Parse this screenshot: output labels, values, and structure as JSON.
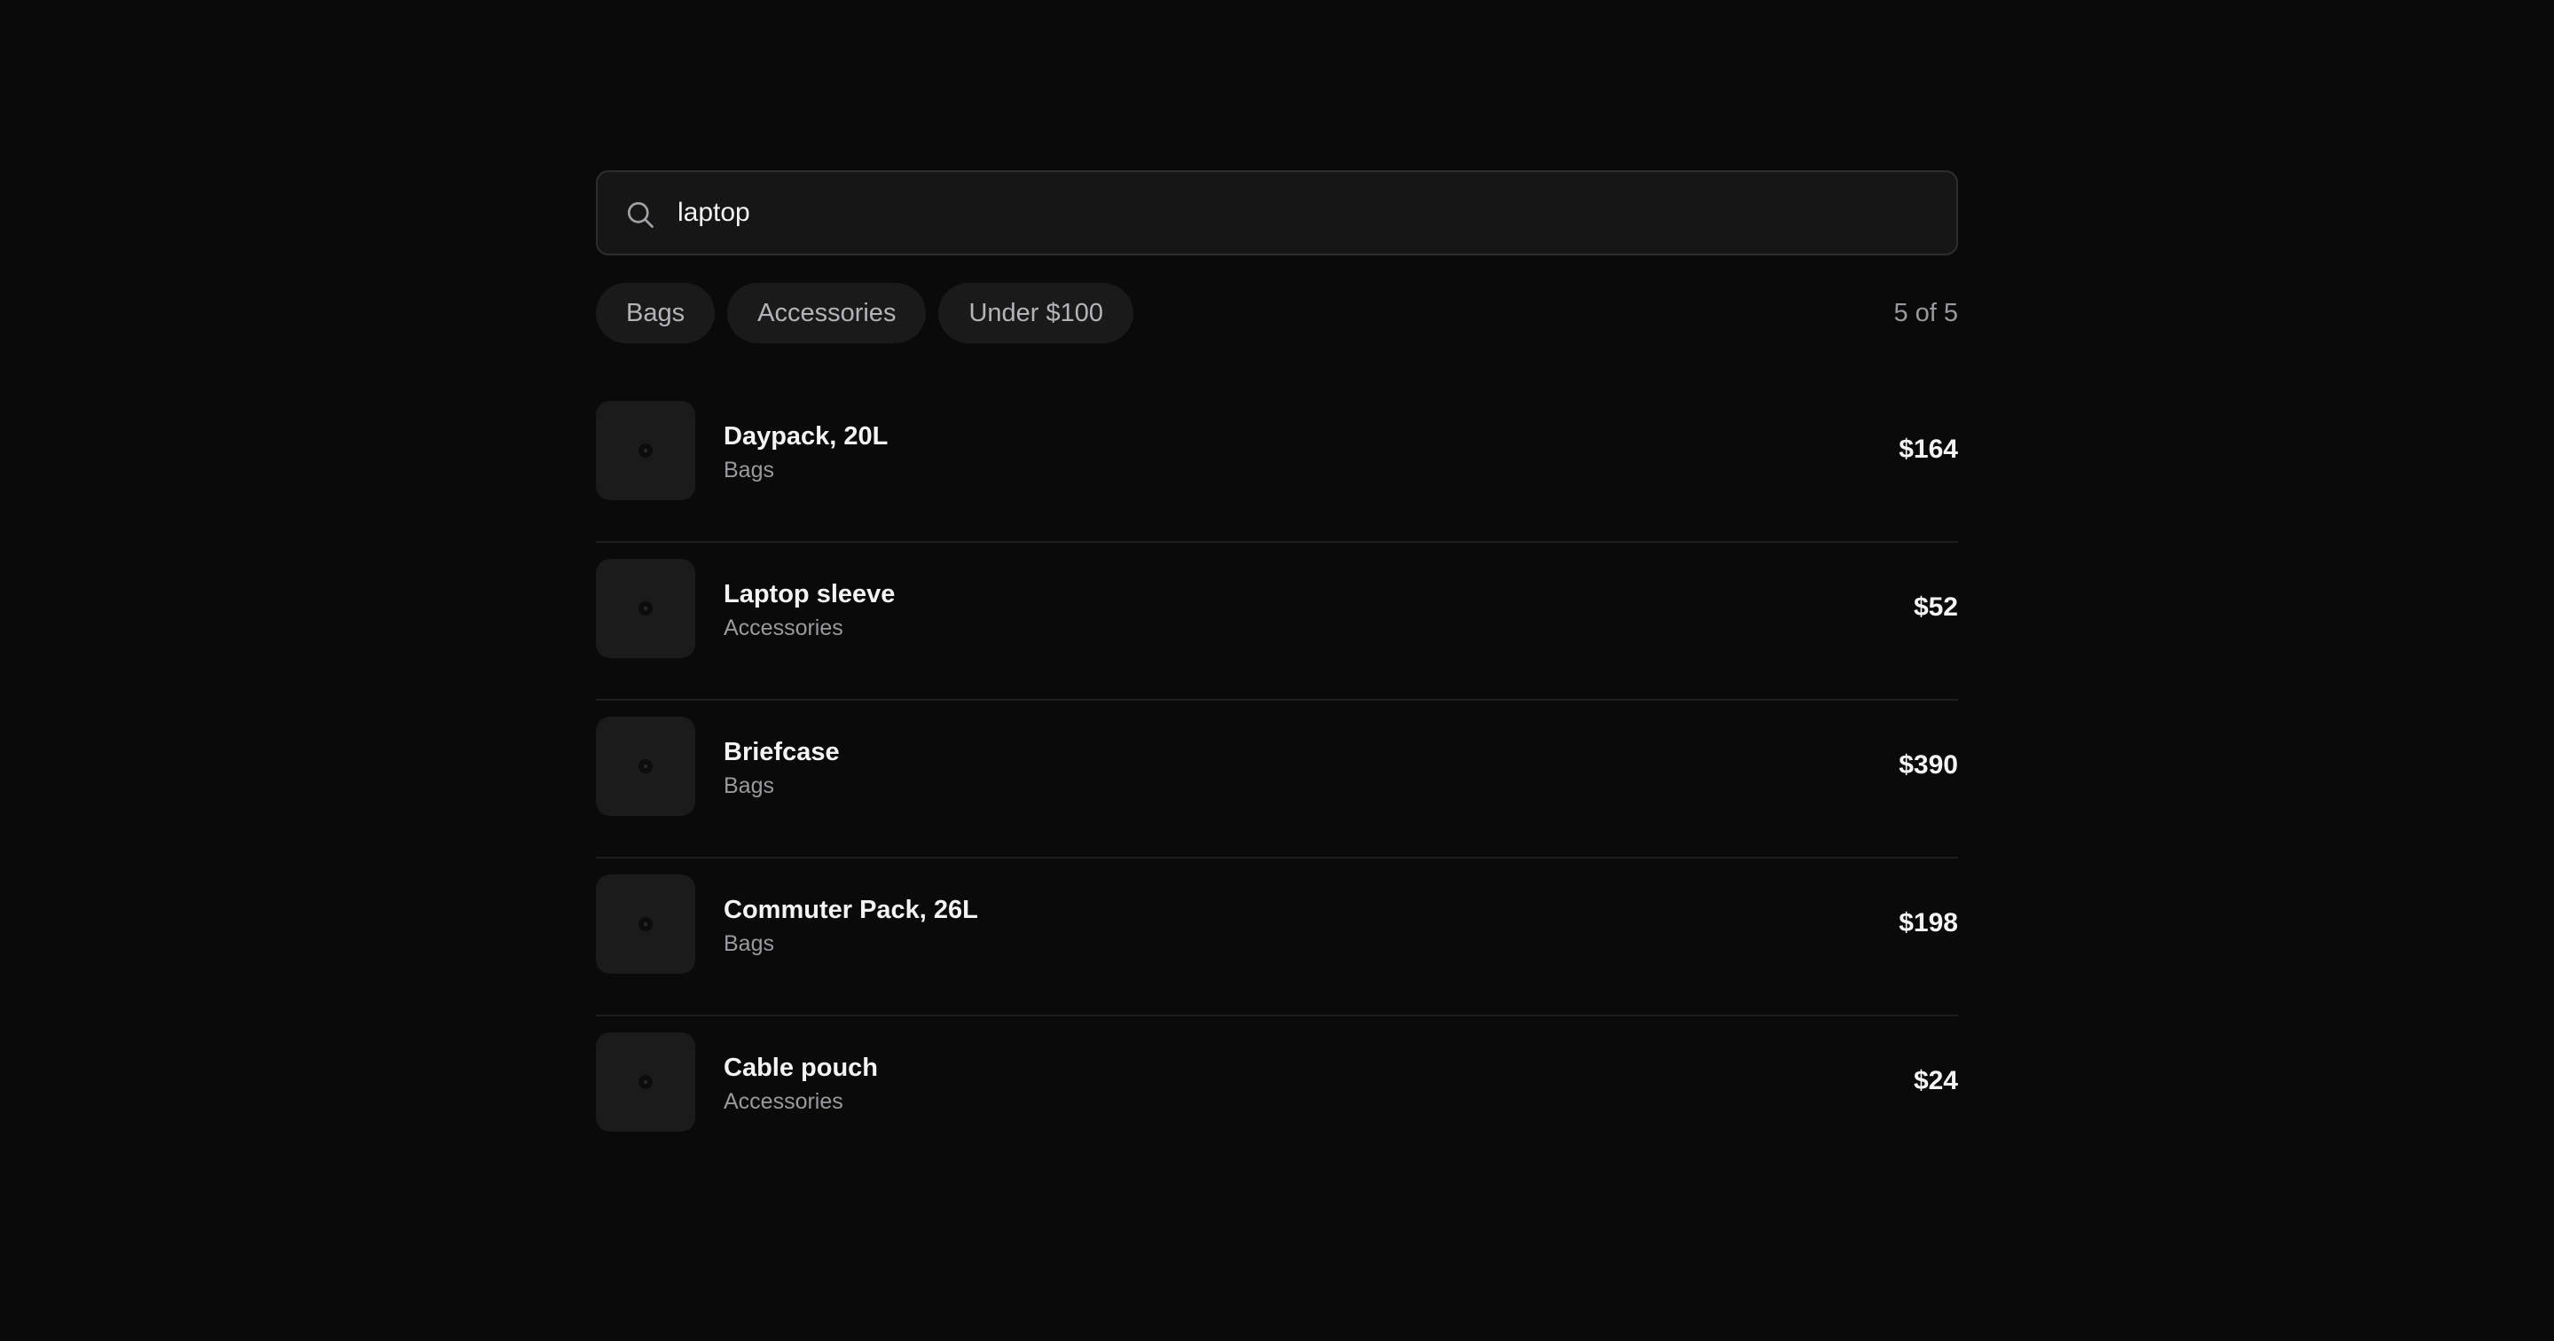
{
  "search": {
    "value": "laptop",
    "icon": "search-icon"
  },
  "filters": [
    {
      "label": "Bags"
    },
    {
      "label": "Accessories"
    },
    {
      "label": "Under $100"
    }
  ],
  "result_count": "5 of 5",
  "items": [
    {
      "name": "Daypack, 20L",
      "category": "Bags",
      "price": "$164"
    },
    {
      "name": "Laptop sleeve",
      "category": "Accessories",
      "price": "$52"
    },
    {
      "name": "Briefcase",
      "category": "Bags",
      "price": "$390"
    },
    {
      "name": "Commuter Pack, 26L",
      "category": "Bags",
      "price": "$198"
    },
    {
      "name": "Cable pouch",
      "category": "Accessories",
      "price": "$24"
    }
  ],
  "colors": {
    "background": "#0a0a0a",
    "surface": "#161616",
    "chip": "#1a1a1a",
    "text_primary": "#f4f4f5",
    "text_secondary": "#9a9a9e"
  }
}
